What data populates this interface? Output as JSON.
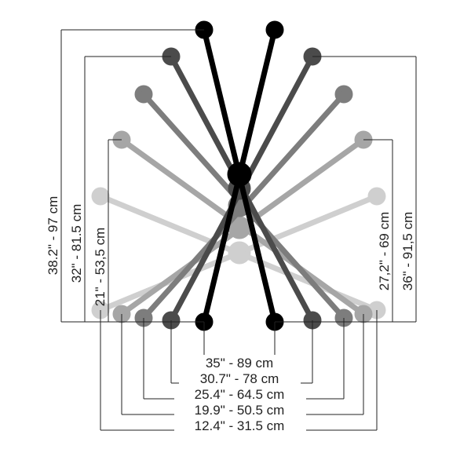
{
  "dimensions": {
    "top": [
      {
        "imperial": "38.2\"",
        "metric": "97 cm"
      },
      {
        "imperial": "32\"",
        "metric": "81.5 cm"
      },
      {
        "imperial": "21\"",
        "metric": "53,5 cm"
      }
    ],
    "bottom_right": [
      {
        "imperial": "27,2\"",
        "metric": "69 cm"
      },
      {
        "imperial": "36\"",
        "metric": "91,5 cm"
      }
    ],
    "widths": [
      {
        "imperial": "35\"",
        "metric": "89 cm"
      },
      {
        "imperial": "30.7\"",
        "metric": "78 cm"
      },
      {
        "imperial": "25.4\"",
        "metric": "64.5 cm"
      },
      {
        "imperial": "19.9\"",
        "metric": "50.5 cm"
      },
      {
        "imperial": "12.4\"",
        "metric": "31.5 cm"
      }
    ]
  },
  "colors": {
    "shade1": "#000000",
    "shade2": "#4b4b4b",
    "shade3": "#7d7d7d",
    "shade4": "#a6a6a6",
    "shade5": "#cfcfcf",
    "line": "#222"
  }
}
